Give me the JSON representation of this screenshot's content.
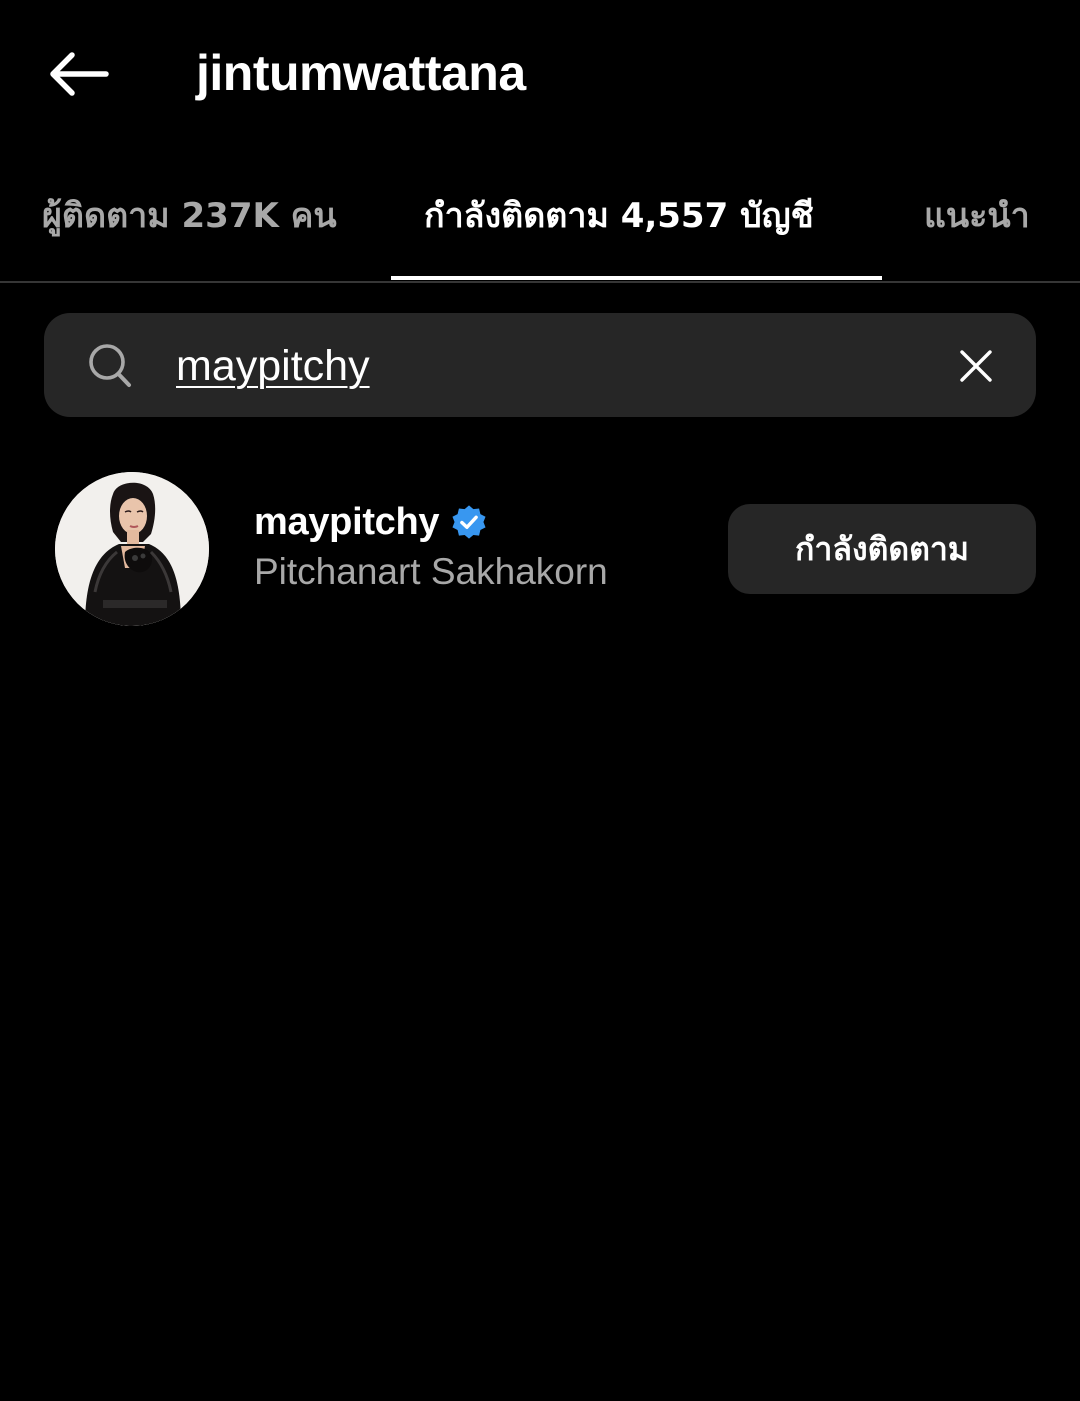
{
  "header": {
    "title": "jintumwattana",
    "back_icon": "arrow-left-icon"
  },
  "tabs": [
    {
      "label": "ผู้ติดตาม 237K คน",
      "active": false
    },
    {
      "label": "กำลังติดตาม 4,557 บัญชี",
      "active": true
    },
    {
      "label": "แนะนำ",
      "active": false
    }
  ],
  "search": {
    "value": "maypitchy",
    "search_icon": "search-icon",
    "clear_icon": "close-icon"
  },
  "results": [
    {
      "username": "maypitchy",
      "verified": true,
      "full_name": "Pitchanart Sakhakorn",
      "button_label": "กำลังติดตาม",
      "avatar_icon": "avatar"
    }
  ],
  "colors": {
    "background": "#000000",
    "text_primary": "#ffffff",
    "text_secondary": "#a8a8a8",
    "surface": "#262626",
    "verified_blue": "#3897f0"
  }
}
